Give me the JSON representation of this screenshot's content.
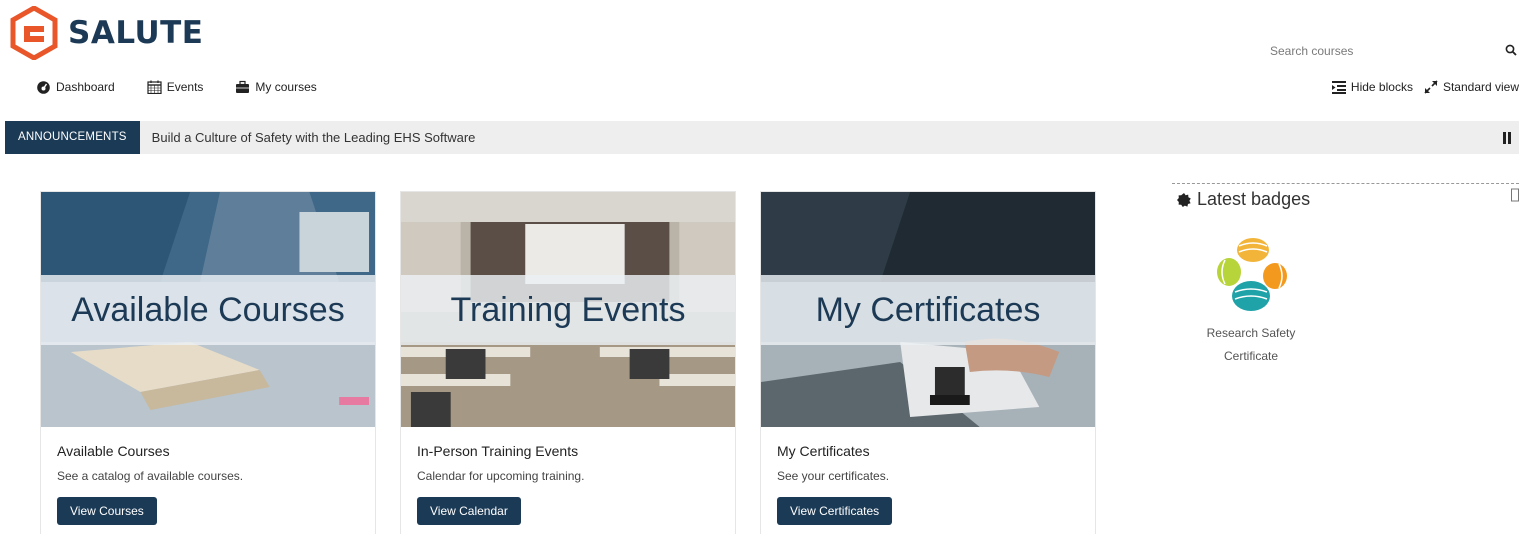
{
  "brand": {
    "name": "SALUTE",
    "color": "#1c3a55",
    "accent": "#e8562a"
  },
  "search": {
    "placeholder": "Search courses"
  },
  "nav": {
    "dashboard": "Dashboard",
    "events": "Events",
    "my_courses": "My courses"
  },
  "view_controls": {
    "hide_blocks": "Hide blocks",
    "standard_view": "Standard view"
  },
  "announcement": {
    "label": "ANNOUNCEMENTS",
    "text": "Build a Culture of Safety with the Leading EHS Software"
  },
  "cards": [
    {
      "banner": "Available Courses",
      "title": "Available Courses",
      "description": "See a catalog of available courses.",
      "button": "View Courses"
    },
    {
      "banner": "Training Events",
      "title": "In-Person Training Events",
      "description": "Calendar for upcoming training.",
      "button": "View Calendar"
    },
    {
      "banner": "My Certificates",
      "title": "My Certificates",
      "description": "See your certificates.",
      "button": "View Certificates"
    }
  ],
  "badges_block": {
    "title": "Latest badges",
    "badge_name_line1": "Research Safety",
    "badge_name_line2": "Certificate"
  },
  "colors": {
    "primary_dark": "#1b3a56",
    "announce_bg": "#eeeeee"
  }
}
